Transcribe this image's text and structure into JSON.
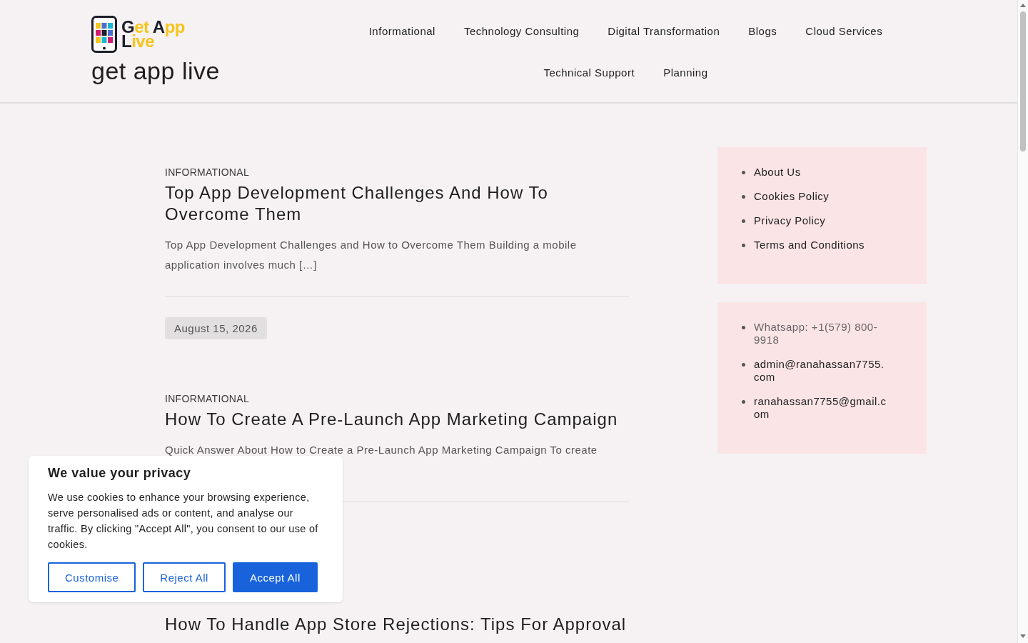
{
  "header": {
    "logo_text": "Get App Live",
    "site_title": "get app live",
    "nav": [
      {
        "label": "Informational"
      },
      {
        "label": "Technology Consulting"
      },
      {
        "label": "Digital Transformation"
      },
      {
        "label": "Blogs"
      },
      {
        "label": "Cloud Services"
      },
      {
        "label": "Technical Support"
      },
      {
        "label": "Planning"
      }
    ]
  },
  "posts": [
    {
      "category": "INFORMATIONAL",
      "title": "Top App Development Challenges And How To Overcome Them",
      "excerpt": "Top App Development Challenges and How to Overcome Them Building a mobile application involves much […]",
      "date": "August 15, 2026"
    },
    {
      "category": "INFORMATIONAL",
      "title": "How To Create A Pre-Launch App Marketing Campaign",
      "excerpt": "Quick Answer About How to Create a Pre-Launch App Marketing Campaign To create"
    },
    {
      "title": "How To Handle App Store Rejections: Tips For Approval"
    }
  ],
  "sidebar": [
    {
      "links": [
        {
          "label": "About Us"
        },
        {
          "label": "Cookies Policy"
        },
        {
          "label": "Privacy Policy"
        },
        {
          "label": "Terms and Conditions"
        }
      ]
    },
    {
      "links": [
        {
          "label": "Whatsapp: +1(579) 800-9918",
          "muted": true
        },
        {
          "label": "admin@ranahassan7755.com",
          "muted": false
        },
        {
          "label": "ranahassan7755@gmail.com",
          "muted": false
        }
      ]
    }
  ],
  "cookie_banner": {
    "title": "We value your privacy",
    "text": "We use cookies to enhance your browsing experience, serve personalised ads or content, and analyse our traffic. By clicking \"Accept All\", you consent to our use of cookies.",
    "buttons": [
      {
        "label": "Customise",
        "kind": "outline"
      },
      {
        "label": "Reject All",
        "kind": "outline"
      },
      {
        "label": "Accept All",
        "kind": "primary"
      }
    ]
  }
}
